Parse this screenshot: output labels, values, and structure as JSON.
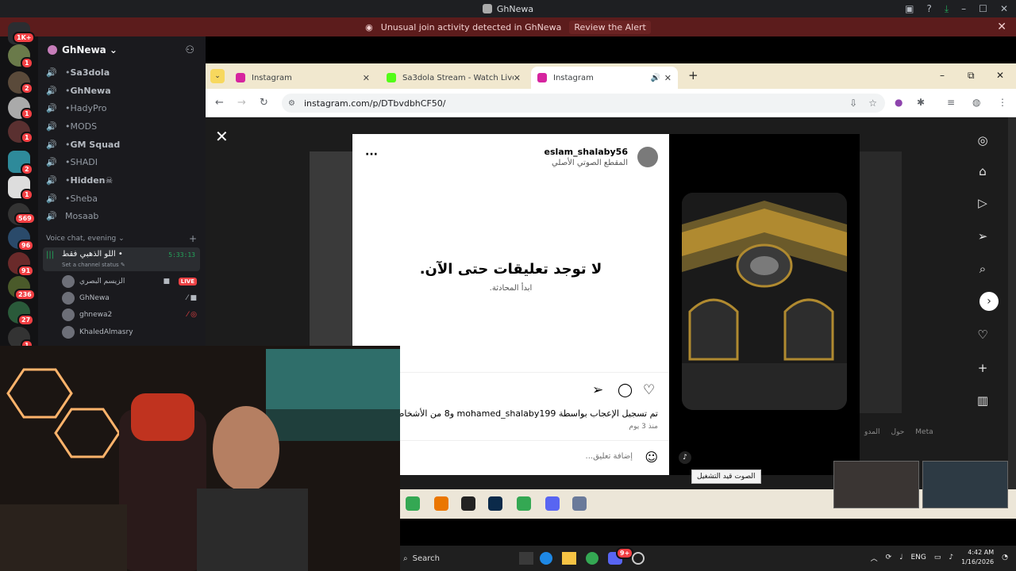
{
  "titlebar": {
    "title": "GhNewa"
  },
  "alert": {
    "text": "Unusual join activity detected in GhNewa",
    "action": "Review the Alert"
  },
  "rail": {
    "top_badge": "1K+",
    "badges": [
      "1",
      "2",
      "1",
      "1",
      "2",
      "1",
      "1",
      "569",
      "96",
      "91",
      "236",
      "27",
      "1"
    ]
  },
  "server": {
    "name": "GhNewa ⌄"
  },
  "channels": [
    {
      "name": "Sa3dola",
      "bold": true
    },
    {
      "name": "GhNewa",
      "bold": true
    },
    {
      "name": "HadyPro",
      "bold": false
    },
    {
      "name": "MODS",
      "bold": false
    },
    {
      "name": "GM Squad",
      "bold": true
    },
    {
      "name": "SHADI",
      "bold": false
    },
    {
      "name": "Hidden☠",
      "bold": true
    },
    {
      "name": "Sheba",
      "bold": false
    },
    {
      "name": "Mosaab",
      "bold": false
    }
  ],
  "voice": {
    "header": "Voice chat, evening ⌄",
    "active_channel": "اللو الذهبي فقط •",
    "timer": "5:33:13",
    "status": "Set a channel status ✎",
    "users": [
      {
        "name": "الزيسم البصري",
        "live": "LIVE"
      },
      {
        "name": "GhNewa",
        "live": ""
      },
      {
        "name": "ghnewa2",
        "live": ""
      },
      {
        "name": "KhaledAlmasry",
        "live": ""
      }
    ]
  },
  "browser": {
    "tabs": [
      {
        "label": "Instagram",
        "color": "#d6249f"
      },
      {
        "label": "Sa3dola Stream - Watch Live on",
        "color": "#53fc18"
      },
      {
        "label": "Instagram",
        "color": "#d6249f"
      }
    ],
    "url": "instagram.com/p/DTbvdbhCF50/"
  },
  "post": {
    "username": "eslam_shalaby56",
    "audio": "المقطع الصوتي الأصلي",
    "no_comments": "لا توجد تعليقات حتى الآن.",
    "start_conversation": "ابدأ المحادثة.",
    "likes": "تم تسجيل الإعجاب بواسطة mohamed_shalaby199 و8 من الأشخاص",
    "posted": "منذ 3 يوم",
    "comment_placeholder": "إضافة تعليق...",
    "sound_tooltip": "الصوت قيد التشغيل"
  },
  "meta_links": [
    "Meta",
    "حول",
    "المدو"
  ],
  "taskbar": {
    "search": "Search",
    "lang": "ENG",
    "time": "4:42 AM",
    "date": "1/16/2026",
    "discord_badge": "9+"
  },
  "colors": {
    "alert_bg": "#5c1c1c",
    "discord_bg": "#1a1a1e",
    "live": "#ed4245",
    "tab_bar": "#f1e8cf"
  }
}
